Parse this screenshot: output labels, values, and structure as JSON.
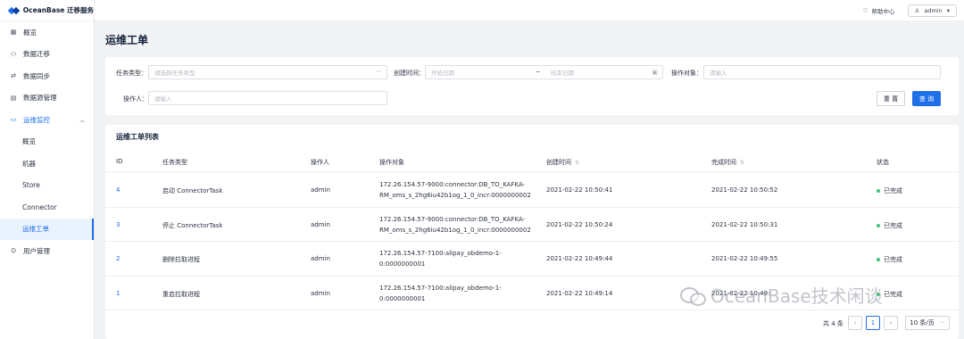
{
  "app": {
    "logo_text": "OceanBase 迁移服务"
  },
  "sidebar": {
    "items": [
      {
        "label": "概览",
        "icon": "overview-icon"
      },
      {
        "label": "数据迁移",
        "icon": "migration-icon"
      },
      {
        "label": "数据同步",
        "icon": "sync-icon"
      },
      {
        "label": "数据源管理",
        "icon": "datasource-icon"
      },
      {
        "label": "运维监控",
        "icon": "monitor-icon",
        "expanded": true
      },
      {
        "label": "用户管理",
        "icon": "user-manage-icon"
      }
    ],
    "sub_items": [
      {
        "label": "概览"
      },
      {
        "label": "机器"
      },
      {
        "label": "Store"
      },
      {
        "label": "Connector"
      },
      {
        "label": "运维工单",
        "active": true
      }
    ]
  },
  "topbar": {
    "help_label": "帮助中心",
    "user_label": "admin"
  },
  "page": {
    "title": "运维工单"
  },
  "filters": {
    "task_type_label": "任务类型：",
    "task_type_placeholder": "请选择任务类型",
    "created_label": "创建时间：",
    "start_placeholder": "开始日期",
    "range_sep": "~",
    "end_placeholder": "结束日期",
    "target_label": "操作对象：",
    "target_placeholder": "请输入",
    "operator_label": "操作人：",
    "operator_placeholder": "请输入",
    "reset_label": "重 置",
    "query_label": "查 询"
  },
  "table": {
    "title": "运维工单列表",
    "columns": [
      "ID",
      "任务类型",
      "操作人",
      "操作对象",
      "创建时间",
      "完成时间",
      "状态"
    ],
    "rows": [
      {
        "id": "4",
        "type": "启动 ConnectorTask",
        "operator": "admin",
        "target_line1": "172.26.154.57-9000:connector:DB_TO_KAFKA-",
        "target_line2": "RM_oms_s_2hg6iu42b1og_1_0_incr:0000000002",
        "created": "2021-02-22 10:50:41",
        "finished": "2021-02-22 10:50:52",
        "status": "已完成"
      },
      {
        "id": "3",
        "type": "停止 ConnectorTask",
        "operator": "admin",
        "target_line1": "172.26.154.57-9000:connector:DB_TO_KAFKA-",
        "target_line2": "RM_oms_s_2hg6iu42b1og_1_0_incr:0000000002",
        "created": "2021-02-22 10:50:24",
        "finished": "2021-02-22 10:50:31",
        "status": "已完成"
      },
      {
        "id": "2",
        "type": "删除拉取进程",
        "operator": "admin",
        "target_line1": "172.26.154.57-7100:alipay_obdemo-1-",
        "target_line2": "0:0000000001",
        "created": "2021-02-22 10:49:44",
        "finished": "2021-02-22 10:49:55",
        "status": "已完成"
      },
      {
        "id": "1",
        "type": "重启拉取进程",
        "operator": "admin",
        "target_line1": "172.26.154.57-7100:alipay_obdemo-1-",
        "target_line2": "0:0000000001",
        "created": "2021-02-22 10:49:14",
        "finished": "2021-02-22 10:49:",
        "status": "已完成"
      }
    ]
  },
  "pagination": {
    "total_label": "共 4 条",
    "current_page": "1",
    "page_size_label": "10 条/页"
  },
  "watermark": {
    "text": "OceanBase技术闲谈"
  },
  "colors": {
    "accent": "#1e6fe8",
    "success": "#3ec27c",
    "background": "#f2f3f5"
  }
}
